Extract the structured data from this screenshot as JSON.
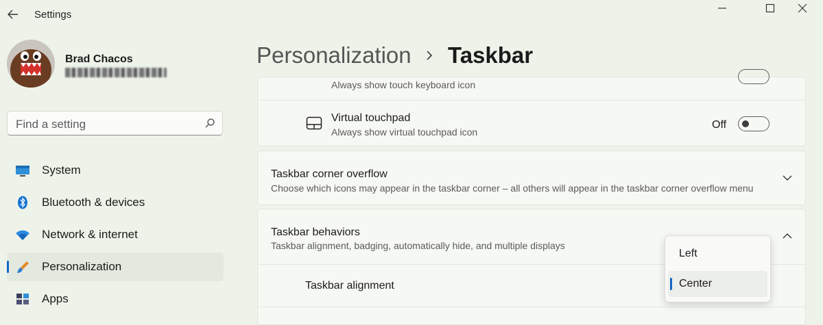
{
  "window": {
    "title": "Settings"
  },
  "user": {
    "name": "Brad Chacos"
  },
  "search": {
    "placeholder": "Find a setting"
  },
  "nav": {
    "items": [
      {
        "label": "System",
        "icon": "system-icon"
      },
      {
        "label": "Bluetooth & devices",
        "icon": "bluetooth-icon"
      },
      {
        "label": "Network & internet",
        "icon": "wifi-icon"
      },
      {
        "label": "Personalization",
        "icon": "brush-icon",
        "selected": true
      },
      {
        "label": "Apps",
        "icon": "apps-icon"
      }
    ]
  },
  "header": {
    "breadcrumb": "Personalization",
    "separator": "›",
    "title": "Taskbar"
  },
  "settings": {
    "touch_keyboard": {
      "subtitle": "Always show touch keyboard icon"
    },
    "virtual_touchpad": {
      "title": "Virtual touchpad",
      "subtitle": "Always show virtual touchpad icon",
      "state": "Off"
    },
    "corner_overflow": {
      "title": "Taskbar corner overflow",
      "subtitle": "Choose which icons may appear in the taskbar corner – all others will appear in the taskbar corner overflow menu"
    },
    "behaviors": {
      "title": "Taskbar behaviors",
      "subtitle": "Taskbar alignment, badging, automatically hide, and multiple displays"
    },
    "alignment": {
      "label": "Taskbar alignment",
      "options": [
        "Left",
        "Center"
      ],
      "selected": "Center"
    }
  },
  "colors": {
    "accent": "#1367c3",
    "background": "#eef3ea",
    "card": "#f6f8f4"
  }
}
